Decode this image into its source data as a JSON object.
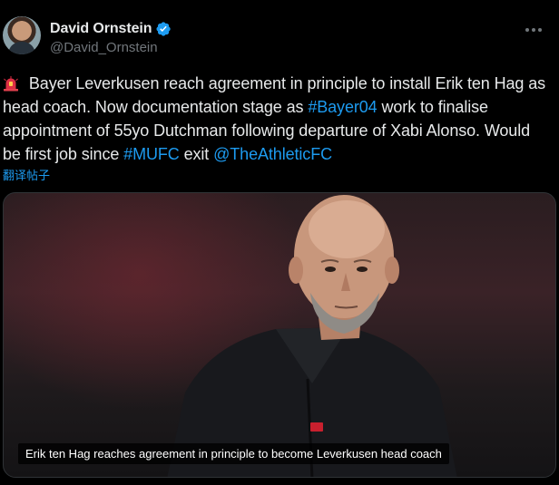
{
  "author": {
    "display_name": "David Ornstein",
    "handle": "@David_Ornstein",
    "avatar_icon": "avatar-photo",
    "verified_icon": "verified-badge-icon",
    "verified_color": "#1d9bf0"
  },
  "tweet": {
    "part1": " Bayer Leverkusen reach agreement in principle to install Erik ten Hag as head coach. Now documentation stage as ",
    "hashtag1": "#Bayer04",
    "part2": " work to finalise appointment of 55yo Dutchman following departure of Xabi Alonso. Would be first job since ",
    "hashtag2": "#MUFC",
    "part3": " exit ",
    "mention": "@TheAthleticFC",
    "siren_icon": "siren-emoji-icon"
  },
  "translate_label": "翻译帖子",
  "media": {
    "caption": "Erik ten Hag reaches agreement in principle to become Leverkusen head coach"
  },
  "colors": {
    "background": "#000000",
    "text": "#e7e9ea",
    "muted": "#71767b",
    "link": "#1d9bf0"
  }
}
